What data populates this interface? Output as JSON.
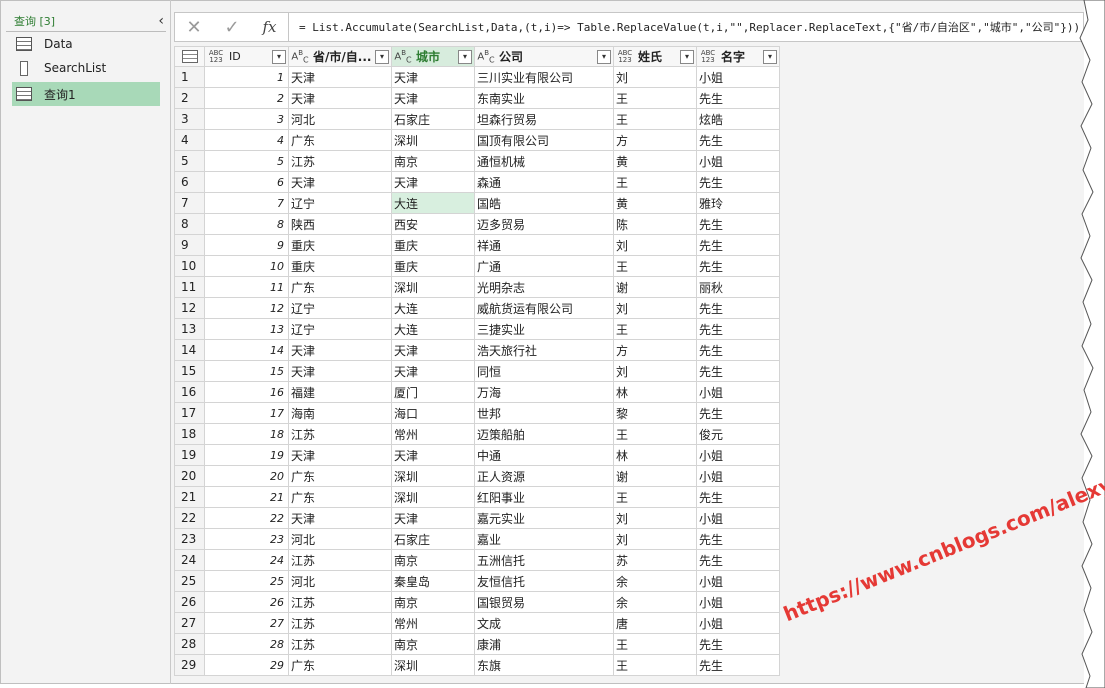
{
  "queries": {
    "header": "查询 [3]",
    "items": [
      {
        "label": "Data",
        "icon": "table-icon"
      },
      {
        "label": "SearchList",
        "icon": "list-icon"
      },
      {
        "label": "查询1",
        "icon": "table-icon"
      }
    ]
  },
  "formula": {
    "cancel": "✕",
    "confirm": "✓",
    "fx": "fx",
    "text": "= List.Accumulate(SearchList,Data,(t,i)=> Table.ReplaceValue(t,i,\"\",Replacer.ReplaceText,{\"省/市/自治区\",\"城市\",\"公司\"}))"
  },
  "grid": {
    "columns": [
      {
        "type": "ABC\n123",
        "name": "ID"
      },
      {
        "type": "AB\nC",
        "name": "省/市/自..."
      },
      {
        "type": "AB\nC",
        "name": "城市"
      },
      {
        "type": "AB\nC",
        "name": "公司"
      },
      {
        "type": "ABC\n123",
        "name": "姓氏"
      },
      {
        "type": "ABC\n123",
        "name": "名字"
      }
    ],
    "rows": [
      [
        "1",
        "1",
        "天津",
        "天津",
        "三川实业有限公司",
        "刘",
        "小姐"
      ],
      [
        "2",
        "2",
        "天津",
        "天津",
        "东南实业",
        "王",
        "先生"
      ],
      [
        "3",
        "3",
        "河北",
        "石家庄",
        "坦森行贸易",
        "王",
        "炫皓"
      ],
      [
        "4",
        "4",
        "广东",
        "深圳",
        "国顶有限公司",
        "方",
        "先生"
      ],
      [
        "5",
        "5",
        "江苏",
        "南京",
        "通恒机械",
        "黄",
        "小姐"
      ],
      [
        "6",
        "6",
        "天津",
        "天津",
        "森通",
        "王",
        "先生"
      ],
      [
        "7",
        "7",
        "辽宁",
        "大连",
        "国皓",
        "黄",
        "雅玲"
      ],
      [
        "8",
        "8",
        "陕西",
        "西安",
        "迈多贸易",
        "陈",
        "先生"
      ],
      [
        "9",
        "9",
        "重庆",
        "重庆",
        "祥通",
        "刘",
        "先生"
      ],
      [
        "10",
        "10",
        "重庆",
        "重庆",
        "广通",
        "王",
        "先生"
      ],
      [
        "11",
        "11",
        "广东",
        "深圳",
        "光明杂志",
        "谢",
        "丽秋"
      ],
      [
        "12",
        "12",
        "辽宁",
        "大连",
        "威航货运有限公司",
        "刘",
        "先生"
      ],
      [
        "13",
        "13",
        "辽宁",
        "大连",
        "三捷实业",
        "王",
        "先生"
      ],
      [
        "14",
        "14",
        "天津",
        "天津",
        "浩天旅行社",
        "方",
        "先生"
      ],
      [
        "15",
        "15",
        "天津",
        "天津",
        "同恒",
        "刘",
        "先生"
      ],
      [
        "16",
        "16",
        "福建",
        "厦门",
        "万海",
        "林",
        "小姐"
      ],
      [
        "17",
        "17",
        "海南",
        "海口",
        "世邦",
        "黎",
        "先生"
      ],
      [
        "18",
        "18",
        "江苏",
        "常州",
        "迈策船舶",
        "王",
        "俊元"
      ],
      [
        "19",
        "19",
        "天津",
        "天津",
        "中通",
        "林",
        "小姐"
      ],
      [
        "20",
        "20",
        "广东",
        "深圳",
        "正人资源",
        "谢",
        "小姐"
      ],
      [
        "21",
        "21",
        "广东",
        "深圳",
        "红阳事业",
        "王",
        "先生"
      ],
      [
        "22",
        "22",
        "天津",
        "天津",
        "嘉元实业",
        "刘",
        "小姐"
      ],
      [
        "23",
        "23",
        "河北",
        "石家庄",
        "嘉业",
        "刘",
        "先生"
      ],
      [
        "24",
        "24",
        "江苏",
        "南京",
        "五洲信托",
        "苏",
        "先生"
      ],
      [
        "25",
        "25",
        "河北",
        "秦皇岛",
        "友恒信托",
        "余",
        "小姐"
      ],
      [
        "26",
        "26",
        "江苏",
        "南京",
        "国银贸易",
        "余",
        "小姐"
      ],
      [
        "27",
        "27",
        "江苏",
        "常州",
        "文成",
        "唐",
        "小姐"
      ],
      [
        "28",
        "28",
        "江苏",
        "南京",
        "康浦",
        "王",
        "先生"
      ],
      [
        "29",
        "29",
        "广东",
        "深圳",
        "东旗",
        "王",
        "先生"
      ]
    ]
  },
  "watermark": "https://www.cnblogs.com/alexywt/"
}
